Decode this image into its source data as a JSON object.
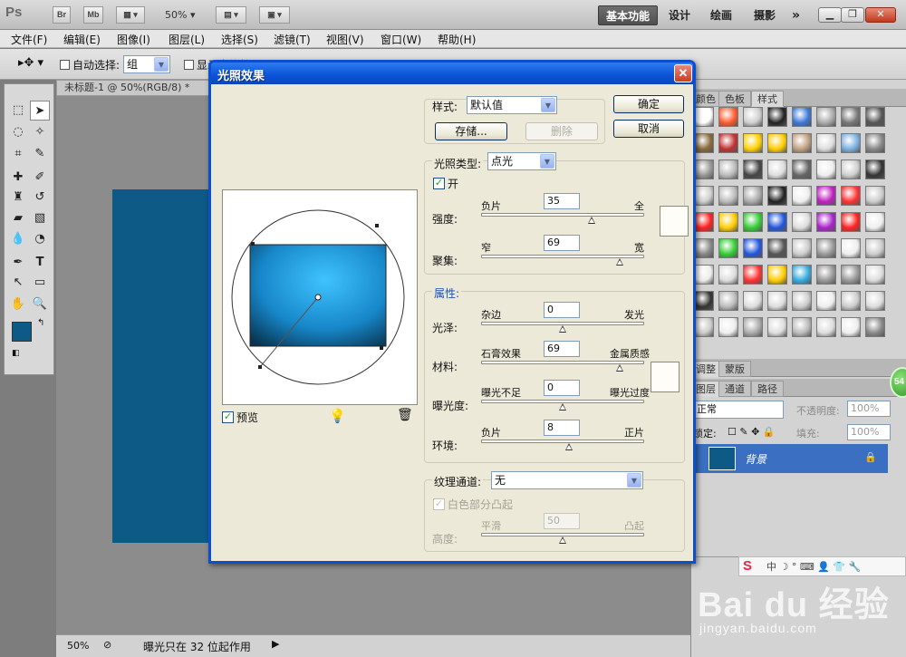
{
  "app": {
    "logo": "Ps",
    "bridge_btn": "Br",
    "minibridge_btn": "Mb",
    "zoom": "50%",
    "workspaces": [
      "基本功能",
      "设计",
      "绘画",
      "摄影"
    ],
    "more": "»"
  },
  "menu": [
    "文件(F)",
    "编辑(E)",
    "图像(I)",
    "图层(L)",
    "选择(S)",
    "滤镜(T)",
    "视图(V)",
    "窗口(W)",
    "帮助(H)"
  ],
  "options": {
    "auto_select_label": "自动选择:",
    "auto_select_value": "组",
    "show_transform_label": "显示变换控件"
  },
  "document": {
    "tab_title": "未标题-1 @ 50%(RGB/8) *",
    "canvas_color": "#0d5a87"
  },
  "status": {
    "zoom": "50%",
    "message": "曝光只在 32 位起作用"
  },
  "panels": {
    "swatch_tabs": [
      "颜色",
      "色板",
      "样式"
    ],
    "adj_tabs": [
      "调整",
      "蒙版"
    ],
    "layer_tabs": [
      "图层",
      "通道",
      "路径"
    ],
    "blend_mode": "正常",
    "opacity_label": "不透明度:",
    "opacity_value": "100%",
    "lock_label": "锁定:",
    "fill_label": "填充:",
    "fill_value": "100%",
    "layer_name": "背景",
    "badge": "54"
  },
  "dialog": {
    "title": "光照效果",
    "style_label": "样式:",
    "style_value": "默认值",
    "save_btn": "存储...",
    "delete_btn": "删除",
    "ok_btn": "确定",
    "cancel_btn": "取消",
    "light_type_label": "光照类型:",
    "light_type_value": "点光",
    "on_label": "开",
    "intensity": {
      "label": "强度:",
      "left": "负片",
      "right": "全",
      "value": "35",
      "fraction": 0.68
    },
    "focus": {
      "label": "聚集:",
      "left": "窄",
      "right": "宽",
      "value": "69",
      "fraction": 0.85
    },
    "properties_header": "属性:",
    "gloss": {
      "label": "光泽:",
      "left": "杂边",
      "right": "发光",
      "value": "0",
      "fraction": 0.5
    },
    "material": {
      "label": "材料:",
      "left": "石膏效果",
      "right": "金属质感",
      "value": "69",
      "fraction": 0.85
    },
    "exposure": {
      "label": "曝光度:",
      "left": "曝光不足",
      "right": "曝光过度",
      "value": "0",
      "fraction": 0.5
    },
    "ambience": {
      "label": "环境:",
      "left": "负片",
      "right": "正片",
      "value": "8",
      "fraction": 0.54
    },
    "texture_label": "纹理通道:",
    "texture_value": "无",
    "white_high_label": "白色部分凸起",
    "height": {
      "label": "高度:",
      "left": "平滑",
      "right": "凸起",
      "value": "50",
      "fraction": 0.5
    },
    "preview_label": "预览"
  },
  "watermark": {
    "brand": "Bai du 经验",
    "url": "jingyan.baidu.com"
  }
}
